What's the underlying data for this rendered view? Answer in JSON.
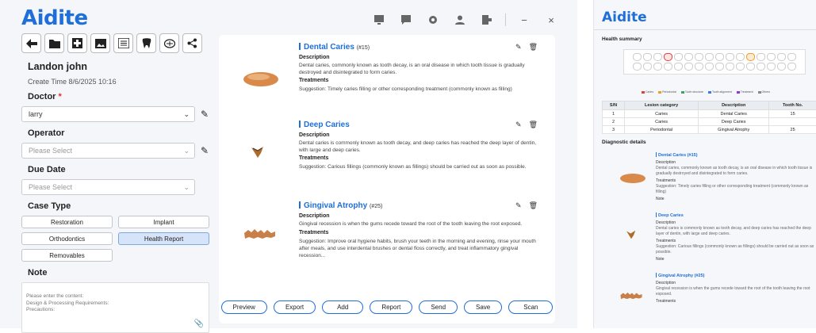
{
  "app": {
    "logo": "Aidite"
  },
  "window_icons": [
    "monitor-icon",
    "feedback-icon",
    "settings-icon",
    "user-icon",
    "logout-icon"
  ],
  "window_controls": {
    "minimize": "−",
    "close": "×"
  },
  "toolbar": [
    "back-icon",
    "folder-icon",
    "add-box-icon",
    "image-icon",
    "xray-icon",
    "tooth-icon",
    "scan-icon",
    "share-icon"
  ],
  "patient": {
    "name": "Landon john",
    "create_time": "Create Time 8/6/2025 10:16"
  },
  "doctor": {
    "label": "Doctor",
    "required": "*",
    "value": "larry"
  },
  "operator": {
    "label": "Operator",
    "placeholder": "Please Select"
  },
  "due_date": {
    "label": "Due Date",
    "placeholder": "Please Select"
  },
  "case_type": {
    "label": "Case Type",
    "options": [
      "Restoration",
      "Implant",
      "Orthodontics",
      "Health Report",
      "Removables"
    ],
    "selected": "Health Report"
  },
  "note": {
    "label": "Note",
    "placeholder": "Please enter the content:\nDesign & Processing Requirements:\nPrecautions:"
  },
  "cards": [
    {
      "title": "Dental Caries",
      "num": "(#15)",
      "desc_label": "Description",
      "desc": "Dental caries, commonly known as tooth decay, is an oral disease in which tooth tissue is gradually destroyed and disintegrated to form caries.",
      "treat_label": "Treatments",
      "treat": "Suggestion: Timely caries filling or other corresponding treatment (commonly known as filling)"
    },
    {
      "title": "Deep Caries",
      "num": "",
      "desc_label": "Description",
      "desc": "Dental caries is commonly known as tooth decay, and deep caries has reached the deep layer of dentin, with large and deep caries.",
      "treat_label": "Treatments",
      "treat": "Suggestion: Carious fillings (commonly known as fillings) should be carried out as soon as possible."
    },
    {
      "title": "Gingival Atrophy",
      "num": "(#25)",
      "desc_label": "Description",
      "desc": "Gingival recession is when the gums recede toward the root of the tooth leaving the root exposed.",
      "treat_label": "Treatments",
      "treat": "Suggestion: Improve oral hygiene habits, brush your teeth in the morning and evening, rinse your mouth after meals, and use interdental brushes or dental floss correctly, and treat inflammatory gingival recession..."
    }
  ],
  "actions": [
    "Preview",
    "Export",
    "Add",
    "Report",
    "Send",
    "Save",
    "Scan"
  ],
  "report": {
    "logo": "Aidite",
    "health_summary": "Health summary",
    "legend": [
      "Caries",
      "Periodontal",
      "Tooth structure",
      "Tooth alignment",
      "Treatment",
      "Others"
    ],
    "legend_colors": [
      "#e0403a",
      "#f19b2c",
      "#3aa65a",
      "#3a7be0",
      "#8a3ae0",
      "#888888"
    ],
    "table_headers": [
      "S/N",
      "Lesion category",
      "Description",
      "Tooth No."
    ],
    "table_rows": [
      [
        "1",
        "Caries",
        "Dental Caries",
        "15"
      ],
      [
        "2",
        "Caries",
        "Deep Caries",
        ""
      ],
      [
        "3",
        "Periodontal",
        "Gingival Atrophy",
        "25"
      ]
    ],
    "diagnostic_details": "Diagnostic details",
    "blocks": [
      {
        "title": "Dental Caries (#15)",
        "desc_label": "Description",
        "desc": "Dental caries, commonly known as tooth decay, is an oral disease in which tooth tissue is gradually destroyed and disintegrated to form caries.",
        "treat_label": "Treatments",
        "treat": "Suggestion: Timely caries filling or other corresponding treatment (commonly known as filling)",
        "note": "Note"
      },
      {
        "title": "Deep Caries",
        "desc_label": "Description",
        "desc": "Dental caries is commonly known as tooth decay, and deep caries has reached the deep layer of dentin, with large and deep caries.",
        "treat_label": "Treatments",
        "treat": "Suggestion: Carious fillings (commonly known as fillings) should be carried out as soon as possible.",
        "note": "Note"
      },
      {
        "title": "Gingival Atrophy (#25)",
        "desc_label": "Description",
        "desc": "Gingival recession is when the gums recede toward the root of the tooth leaving the root exposed.",
        "treat_label": "Treatments",
        "treat": "",
        "note": ""
      }
    ]
  }
}
